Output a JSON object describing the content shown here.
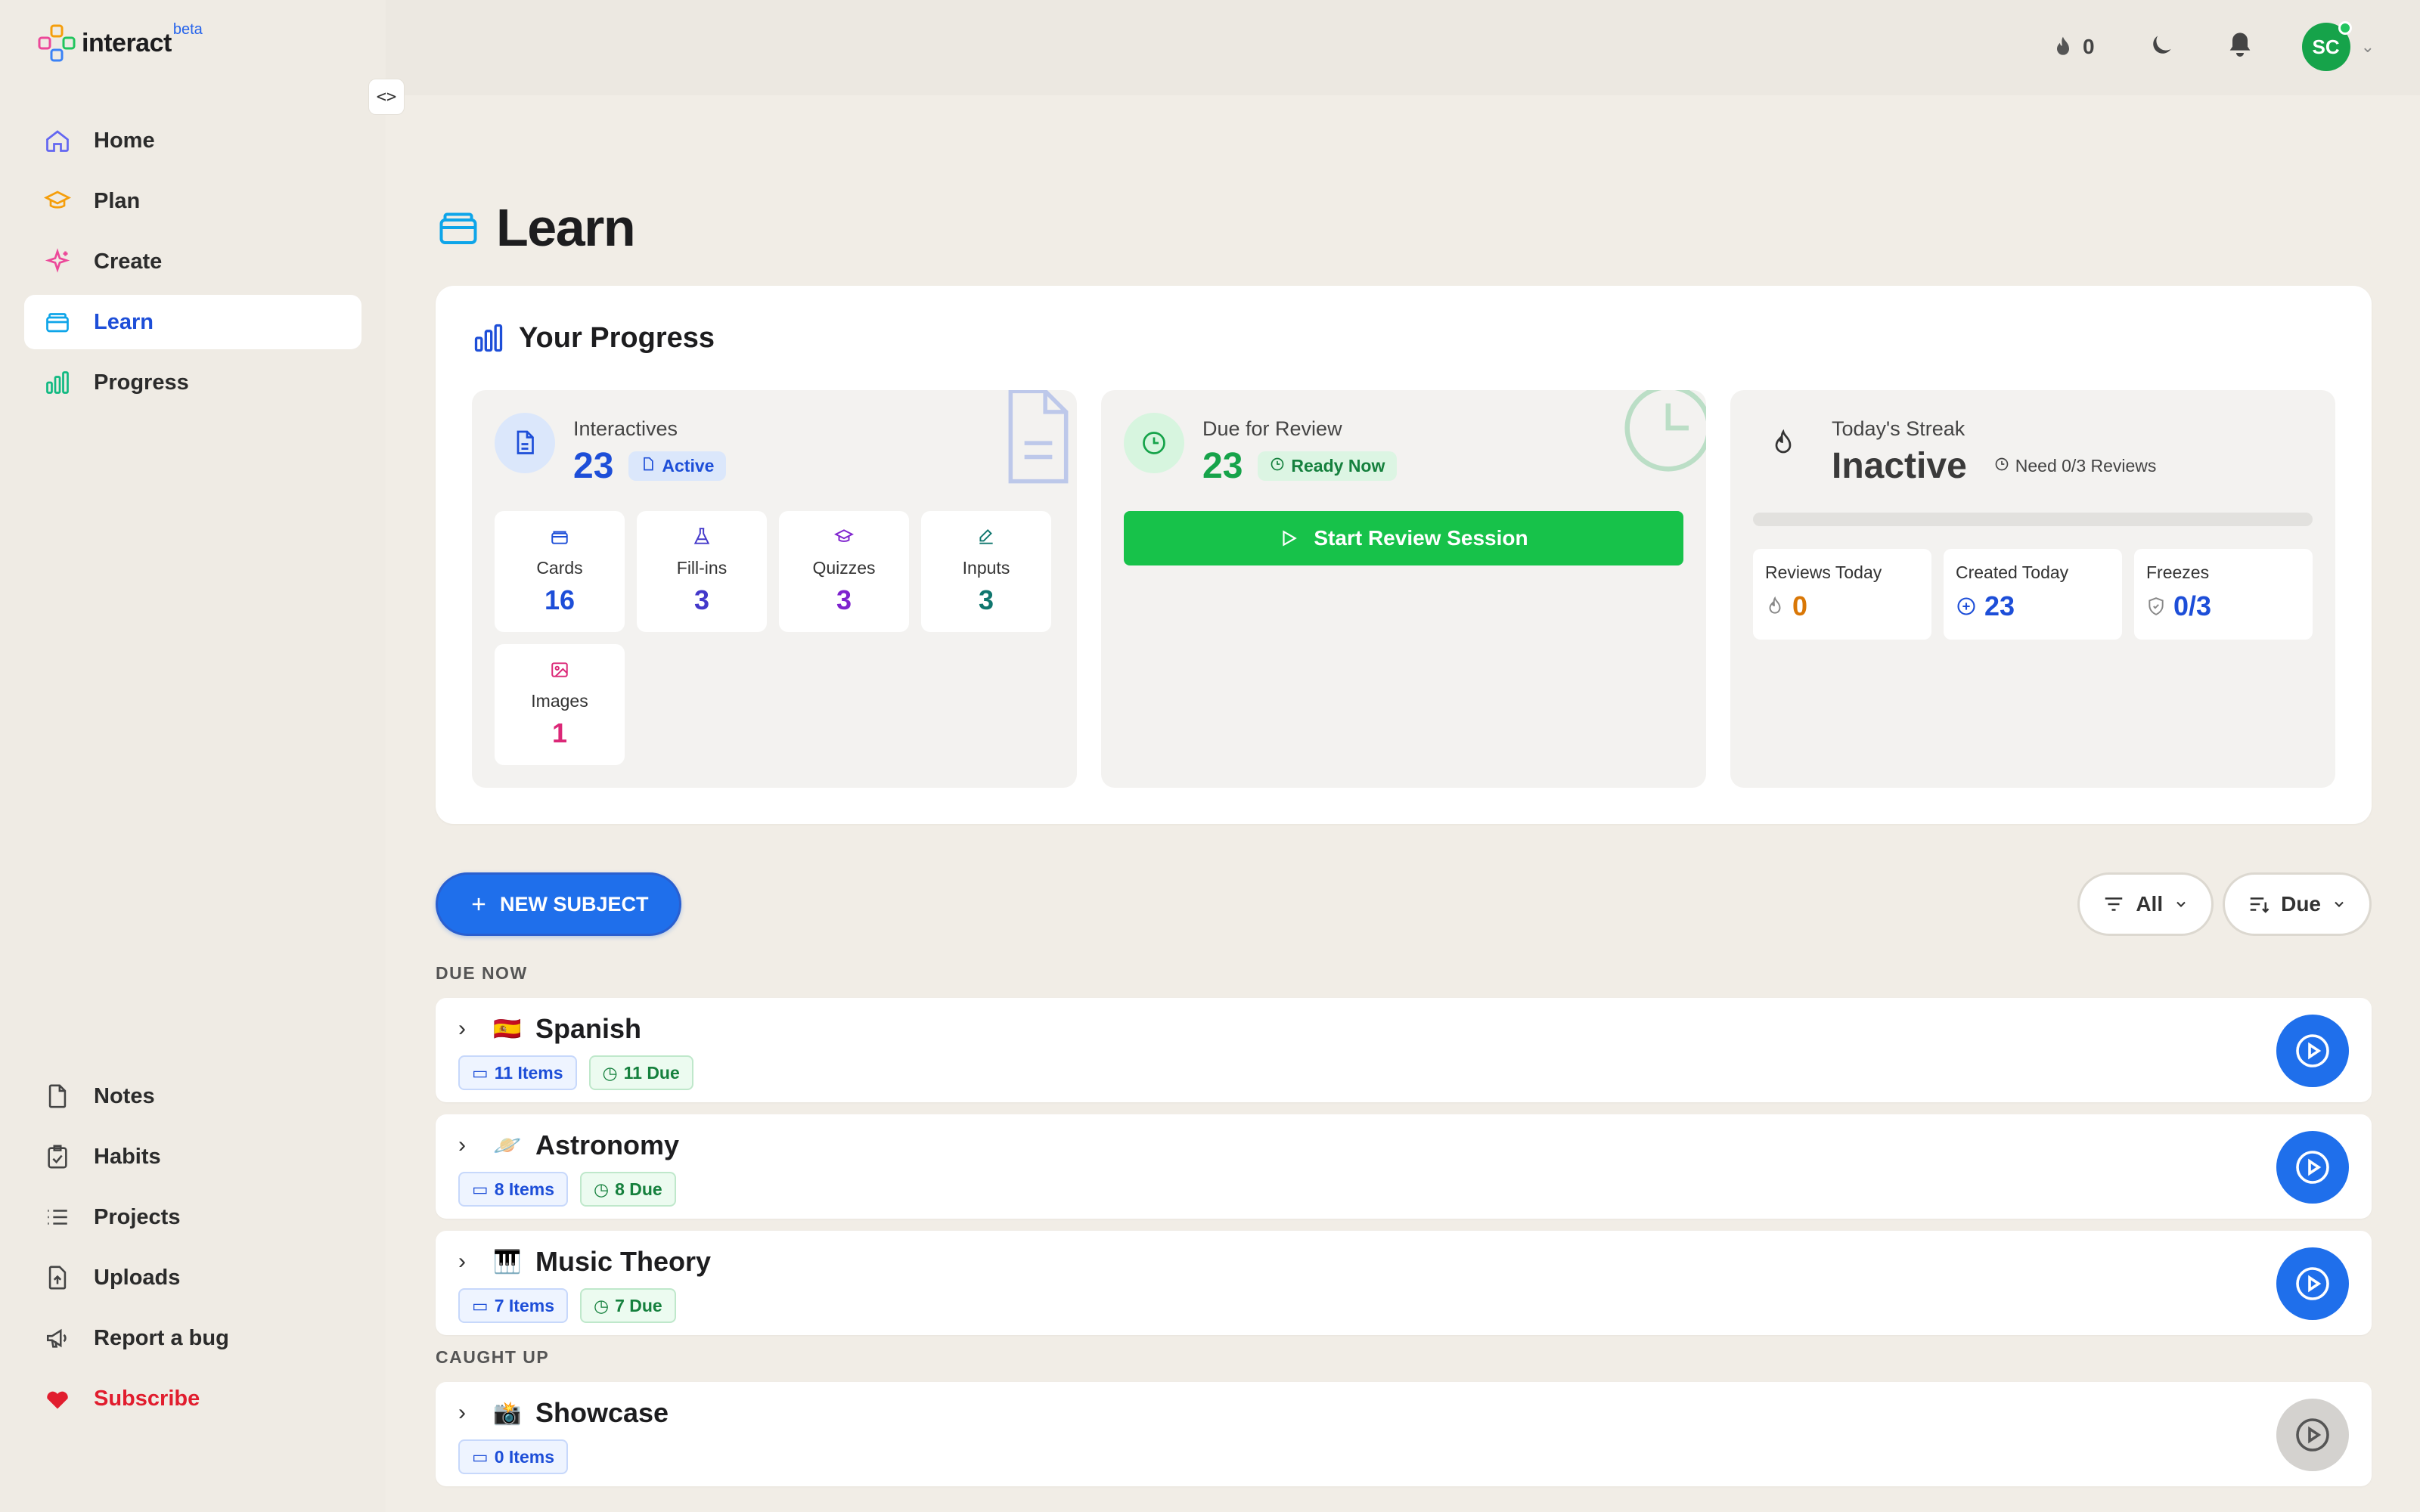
{
  "app": {
    "name": "interact",
    "badge": "beta",
    "accent": "#1f6feb"
  },
  "sidebar": {
    "collapse_toggle": "<>",
    "items": [
      {
        "label": "Home",
        "icon": "home-icon",
        "active": false
      },
      {
        "label": "Plan",
        "icon": "plan-icon",
        "active": false
      },
      {
        "label": "Create",
        "icon": "sparkles-icon",
        "active": false
      },
      {
        "label": "Learn",
        "icon": "cards-icon",
        "active": true
      },
      {
        "label": "Progress",
        "icon": "bar-chart-icon",
        "active": false
      }
    ],
    "bottom_items": [
      {
        "label": "Notes",
        "icon": "file-icon"
      },
      {
        "label": "Habits",
        "icon": "checklist-icon"
      },
      {
        "label": "Projects",
        "icon": "list-icon"
      },
      {
        "label": "Uploads",
        "icon": "upload-icon"
      },
      {
        "label": "Report a bug",
        "icon": "megaphone-icon"
      },
      {
        "label": "Subscribe",
        "icon": "heart-icon"
      }
    ]
  },
  "topbar": {
    "streak_count": "0",
    "avatar_initials": "SC"
  },
  "page": {
    "title": "Learn"
  },
  "progress": {
    "title": "Your Progress",
    "interactives": {
      "label": "Interactives",
      "value": "23",
      "badge": "Active",
      "tiles": [
        {
          "label": "Cards",
          "value": "16",
          "color": "#1d4ed8",
          "icon": "cards-icon"
        },
        {
          "label": "Fill-ins",
          "value": "3",
          "color": "#4338ca",
          "icon": "flask-icon"
        },
        {
          "label": "Quizzes",
          "value": "3",
          "color": "#7e22ce",
          "icon": "graduation-cap-icon"
        },
        {
          "label": "Inputs",
          "value": "3",
          "color": "#0f766e",
          "icon": "edit-icon"
        },
        {
          "label": "Images",
          "value": "1",
          "color": "#db2777",
          "icon": "image-icon"
        }
      ]
    },
    "due": {
      "label": "Due for Review",
      "value": "23",
      "badge": "Ready Now",
      "button": "Start Review Session"
    },
    "streak": {
      "label": "Today's Streak",
      "value": "Inactive",
      "need": "Need 0/3 Reviews",
      "progress": 0,
      "tiles": [
        {
          "label": "Reviews Today",
          "value": "0",
          "color": "#d97706",
          "icon": "flame-icon"
        },
        {
          "label": "Created Today",
          "value": "23",
          "color": "#1d4ed8",
          "icon": "plus-circle-icon"
        },
        {
          "label": "Freezes",
          "value": "0/3",
          "color": "#1d4ed8",
          "icon": "shield-icon"
        }
      ]
    }
  },
  "toolbar": {
    "new_subject": "NEW SUBJECT",
    "filter_label": "All",
    "sort_label": "Due"
  },
  "sections": [
    {
      "label": "DUE NOW",
      "subjects": [
        {
          "emoji": "🇪🇸",
          "name": "Spanish",
          "items": "11 Items",
          "due": "11 Due",
          "active": true
        },
        {
          "emoji": "🪐",
          "name": "Astronomy",
          "items": "8 Items",
          "due": "8 Due",
          "active": true
        },
        {
          "emoji": "🎹",
          "name": "Music Theory",
          "items": "7 Items",
          "due": "7 Due",
          "active": true
        }
      ]
    },
    {
      "label": "CAUGHT UP",
      "subjects": [
        {
          "emoji": "📸",
          "name": "Showcase",
          "items": "0 Items",
          "due": "",
          "active": false
        }
      ]
    }
  ]
}
